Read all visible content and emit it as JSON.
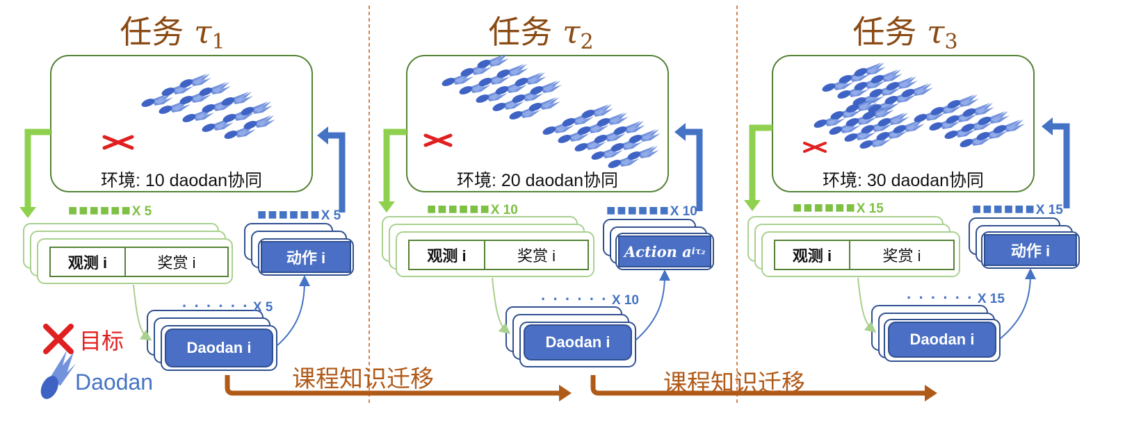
{
  "tasks": [
    {
      "title_prefix": "任务",
      "title_symbol": "τ",
      "title_sub": "1",
      "environment_label": "环境: 10 daodan协同",
      "obs_count": "X 5",
      "action_count": "X 5",
      "daodan_count": "X 5",
      "obs_label": "观测 i",
      "reward_label": "奖赏 i",
      "action_label": "动作 i",
      "daodan_label": "Daodan i"
    },
    {
      "title_prefix": "任务",
      "title_symbol": "τ",
      "title_sub": "2",
      "environment_label": "环境: 20 daodan协同",
      "obs_count": "X 10",
      "action_count": "X 10",
      "daodan_count": "X 10",
      "obs_label": "观测 i",
      "reward_label": "奖赏 i",
      "action_label": "Action a",
      "action_sup": "i",
      "action_sub": "τ₂",
      "daodan_label": "Daodan i"
    },
    {
      "title_prefix": "任务",
      "title_symbol": "τ",
      "title_sub": "3",
      "environment_label": "环境: 30 daodan协同",
      "obs_count": "X 15",
      "action_count": "X 15",
      "daodan_count": "X 15",
      "obs_label": "观测 i",
      "reward_label": "奖赏 i",
      "action_label": "动作 i",
      "daodan_label": "Daodan i"
    }
  ],
  "transfer_labels": [
    "课程知识迁移",
    "课程知识迁移"
  ],
  "legend": {
    "target_label": "目标",
    "daodan_label": "Daodan"
  },
  "colors": {
    "title": "#8a4a14",
    "env_border": "#548235",
    "green_arrow": "#8fd14f",
    "blue_arrow": "#4472c4",
    "pill_fill": "#4a6fc4",
    "pill_border": "#2f4f8f",
    "target_red": "#e02020",
    "transfer_arrow": "#b05a18",
    "divider": "#c55a11"
  },
  "icons": [
    "target-cross-icon",
    "daodan-missile-icon"
  ]
}
